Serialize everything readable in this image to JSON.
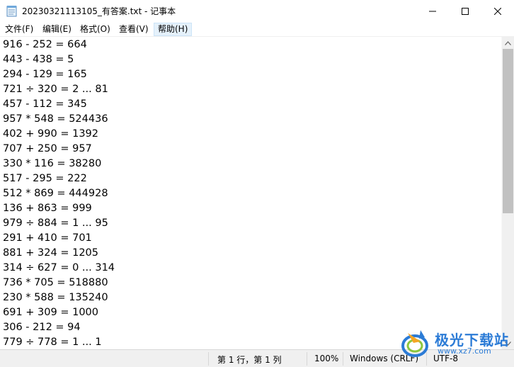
{
  "window": {
    "title": "20230321113105_有答案.txt - 记事本"
  },
  "menu": [
    {
      "label": "文件(F)"
    },
    {
      "label": "编辑(E)"
    },
    {
      "label": "格式(O)"
    },
    {
      "label": "查看(V)"
    },
    {
      "label": "帮助(H)"
    }
  ],
  "editor": {
    "lines": [
      "916 - 252 = 664",
      "443 - 438 = 5",
      "294 - 129 = 165",
      "721 ÷ 320 = 2 ... 81",
      "457 - 112 = 345",
      "957 * 548 = 524436",
      "402 + 990 = 1392",
      "707 + 250 = 957",
      "330 * 116 = 38280",
      "517 - 295 = 222",
      "512 * 869 = 444928",
      "136 + 863 = 999",
      "979 ÷ 884 = 1 ... 95",
      "291 + 410 = 701",
      "881 + 324 = 1205",
      "314 ÷ 627 = 0 ... 314",
      "736 * 705 = 518880",
      "230 * 588 = 135240",
      "691 + 309 = 1000",
      "306 - 212 = 94",
      "779 ÷ 778 = 1 ... 1"
    ]
  },
  "status": {
    "position": "第 1 行，第 1 列",
    "zoom": "100%",
    "line_ending": "Windows (CRLF)",
    "encoding": "UTF-8"
  },
  "watermark": {
    "name": "极光下载站",
    "url": "www.xz7.com"
  },
  "icons": {
    "app": "notepad-icon",
    "minimize": "minimize-icon",
    "maximize": "maximize-icon",
    "close": "close-icon",
    "scroll_up": "chevron-up-icon",
    "scroll_down": "chevron-down-icon"
  },
  "colors": {
    "menu_highlight": "#e5f1fb",
    "statusbar_bg": "#f0f0f0",
    "watermark_blue": "#2b7bd6"
  }
}
